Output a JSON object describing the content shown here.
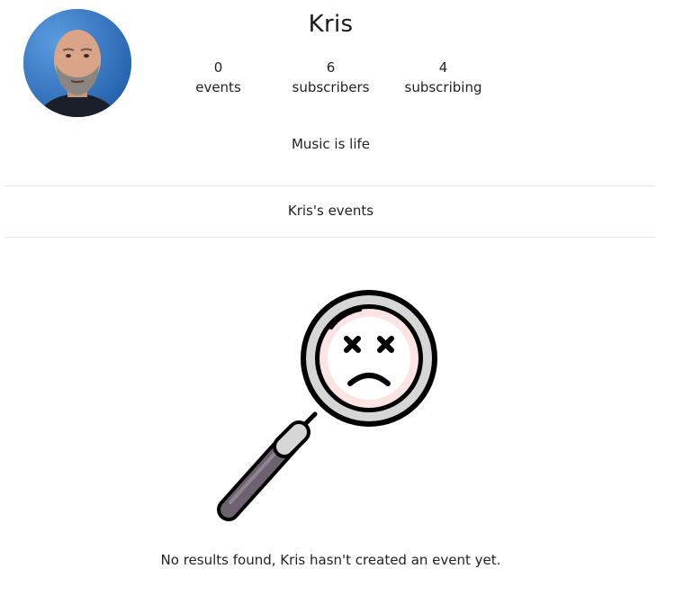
{
  "profile": {
    "name": "Kris",
    "bio": "Music is life",
    "stats": [
      {
        "count": "0",
        "label": "events"
      },
      {
        "count": "6",
        "label": "subscribers"
      },
      {
        "count": "4",
        "label": "subscribing"
      }
    ]
  },
  "events_section": {
    "title": "Kris's events",
    "empty_message": "No results found, Kris hasn't created an event yet."
  },
  "icons": {
    "empty_state": "magnifying-glass-sad-face-icon",
    "avatar": "profile-photo"
  },
  "colors": {
    "divider": "#e3e3e3",
    "lens_tint": "#fce4e4",
    "handle": "#6e6270"
  }
}
